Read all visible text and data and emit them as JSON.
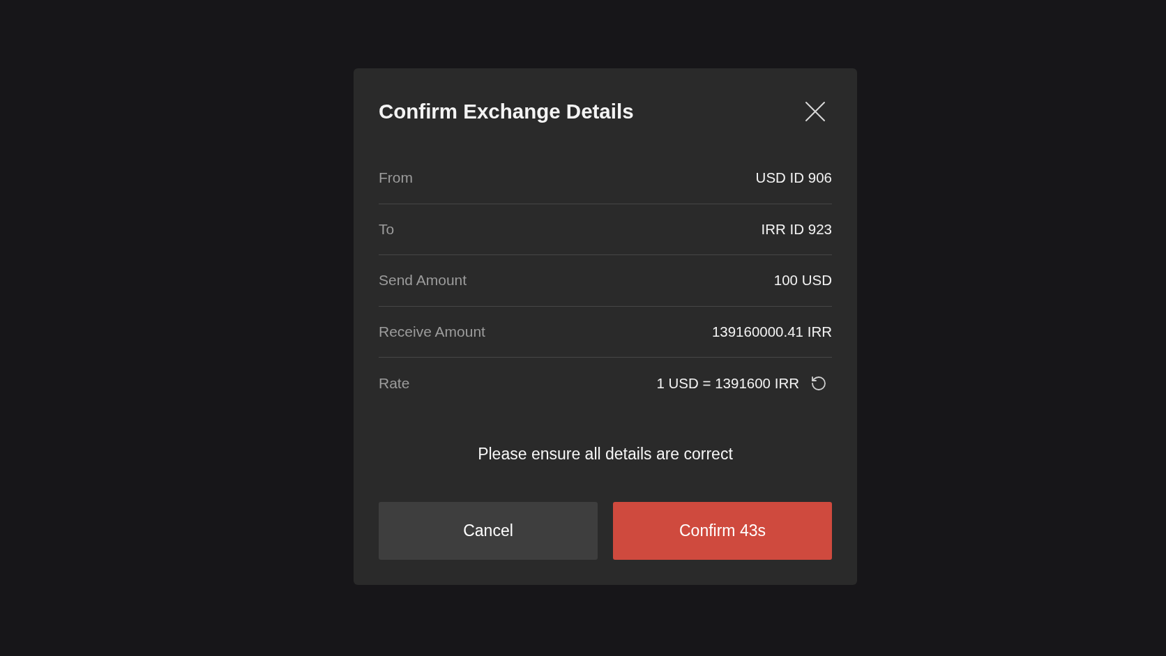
{
  "dialog": {
    "title": "Confirm Exchange Details",
    "details": [
      {
        "kind": "plain",
        "label": "From",
        "value": "USD ID 906"
      },
      {
        "kind": "plain",
        "label": "To",
        "value": "IRR ID 923"
      },
      {
        "kind": "plain",
        "label": "Send Amount",
        "value": "100 USD"
      },
      {
        "kind": "plain",
        "label": "Receive Amount",
        "value": "139160000.41 IRR"
      },
      {
        "kind": "rate",
        "label": "Rate",
        "value": "1 USD = 1391600 IRR"
      }
    ],
    "notice": "Please ensure all details are correct",
    "buttons": [
      {
        "kind": "secondary",
        "label": "Cancel"
      },
      {
        "kind": "primary",
        "label": "Confirm 43s"
      }
    ]
  }
}
